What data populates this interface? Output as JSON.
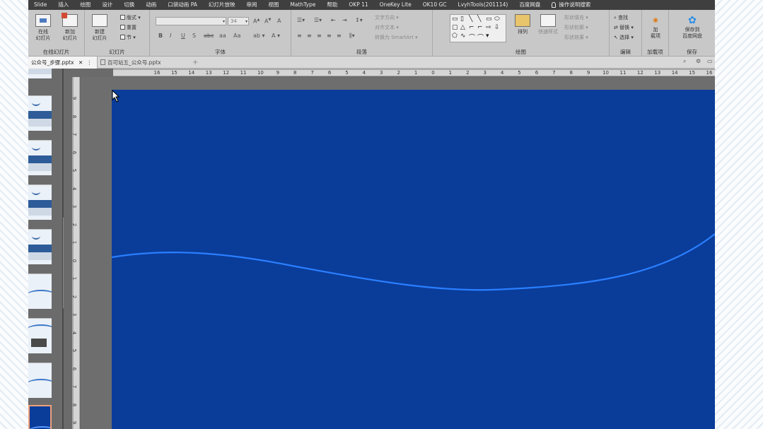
{
  "menu_tabs": [
    "Slide",
    "插入",
    "绘图",
    "设计",
    "切换",
    "动画",
    "口袋动画 PA",
    "幻灯片放映",
    "审阅",
    "视图",
    "MathType",
    "帮助",
    "OKP 11",
    "OneKey Lite",
    "OK10 GC",
    "LvyhTools(201114)",
    "百度网盘"
  ],
  "tell_me": "操作说明搜索",
  "ribbon": {
    "group_cloud": {
      "btn1": "在线\n幻灯片",
      "btn2": "新加\n幻灯片",
      "name": "在线幻灯片"
    },
    "group_slides": {
      "new": "新建\n幻灯片",
      "layout": "版式",
      "reset": "重置",
      "section": "节",
      "name": "幻灯片"
    },
    "group_font": {
      "font_value": "",
      "size_value": "34",
      "bold": "B",
      "italic": "I",
      "underline": "U",
      "strike": "S",
      "spacing": "aa",
      "case": "Aa",
      "name": "字体"
    },
    "group_para": {
      "text_dir": "文字方向",
      "align": "对齐文本",
      "smartart": "转换为 SmartArt",
      "name": "段落"
    },
    "group_draw": {
      "arrange": "排列",
      "quick_styles": "快速样式",
      "fill": "形状填充",
      "outline": "形状轮廓",
      "effects": "形状效果",
      "name": "绘图"
    },
    "group_edit": {
      "find": "查找",
      "replace": "替换",
      "select": "选择",
      "name": "编辑"
    },
    "group_addins": {
      "btn": "加\n载项",
      "name": "加载项"
    },
    "group_save": {
      "btn": "保存到\n百度网盘",
      "name": "保存"
    }
  },
  "doc_tabs": [
    {
      "label": "公众号_步骤.pptx",
      "active": true
    },
    {
      "label": "百可站五_公众号.pptx",
      "active": false
    }
  ],
  "ruler_h": [
    "16",
    "15",
    "14",
    "13",
    "12",
    "11",
    "10",
    "9",
    "8",
    "7",
    "6",
    "5",
    "4",
    "3",
    "2",
    "1",
    "0",
    "1",
    "2",
    "3",
    "4",
    "5",
    "6",
    "7",
    "8",
    "9",
    "10",
    "11",
    "12",
    "13",
    "14",
    "15",
    "16"
  ],
  "ruler_v": [
    "9",
    "8",
    "7",
    "6",
    "5",
    "4",
    "3",
    "2",
    "1",
    "0",
    "1",
    "2",
    "3",
    "4",
    "5",
    "6",
    "7",
    "8",
    "9"
  ],
  "slide": {
    "background": "#0a3c9a",
    "curve_color": "#2a7fff"
  }
}
